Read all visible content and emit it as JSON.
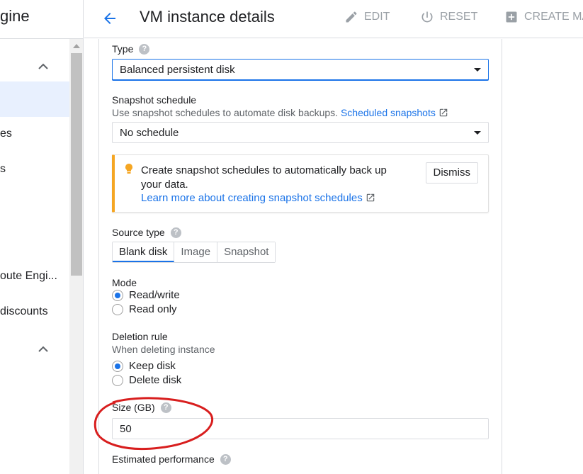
{
  "nav": {
    "brand": "gine",
    "items": [
      {
        "label": "es"
      },
      {
        "label": "s"
      },
      {
        "label": "oute Engi..."
      },
      {
        "label": "discounts"
      }
    ]
  },
  "header": {
    "title": "VM instance details",
    "edit_label": "EDIT",
    "reset_label": "RESET",
    "create_label": "CREATE MA"
  },
  "form": {
    "type": {
      "label": "Type",
      "value": "Balanced persistent disk"
    },
    "snapshot_schedule": {
      "label": "Snapshot schedule",
      "hint": "Use snapshot schedules to automate disk backups.",
      "link": "Scheduled snapshots",
      "value": "No schedule"
    },
    "callout": {
      "text": "Create snapshot schedules to automatically back up your data.",
      "link": "Learn more about creating snapshot schedules",
      "dismiss_label": "Dismiss"
    },
    "source_type": {
      "label": "Source type",
      "options": [
        "Blank disk",
        "Image",
        "Snapshot"
      ],
      "selected": "Blank disk"
    },
    "mode": {
      "label": "Mode",
      "options": [
        "Read/write",
        "Read only"
      ],
      "selected": "Read/write"
    },
    "deletion_rule": {
      "label": "Deletion rule",
      "hint": "When deleting instance",
      "options": [
        "Keep disk",
        "Delete disk"
      ],
      "selected": "Keep disk"
    },
    "size": {
      "label": "Size (GB)",
      "value": "50"
    },
    "estimated_performance": {
      "label": "Estimated performance"
    }
  },
  "colors": {
    "accent": "#1a73e8",
    "callout_bar": "#f5a623",
    "annotation": "#d81e1e"
  }
}
